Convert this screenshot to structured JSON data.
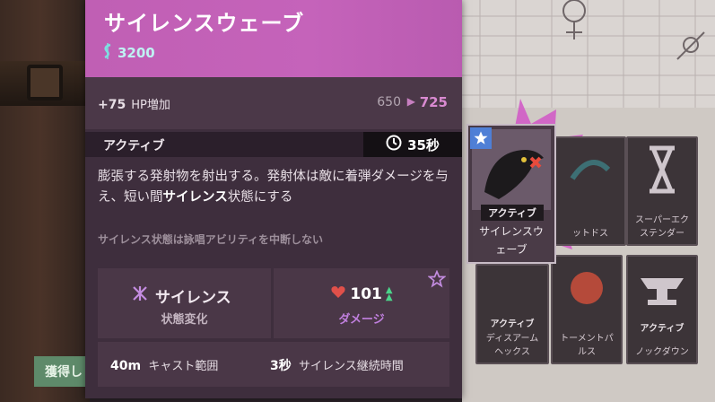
{
  "background": {
    "acquire_button_label": "獲得し"
  },
  "board_cards": {
    "selected": {
      "tag": "アクティブ",
      "name_line1": "サイレンスウ",
      "name_line2": "ェーブ"
    },
    "cards": [
      {
        "tag": "",
        "name_line1": "ットドス",
        "name_line2": ""
      },
      {
        "tag": "",
        "name_line1": "スーパーエク",
        "name_line2": "ステンダー"
      },
      {
        "tag": "アクティブ",
        "name_line1": "ディスアーム",
        "name_line2": "ヘックス"
      },
      {
        "tag": "",
        "name_line1": "トーメントパ",
        "name_line2": "ルス"
      },
      {
        "tag": "アクティブ",
        "name_line1": "ノックダウン",
        "name_line2": ""
      }
    ]
  },
  "tooltip": {
    "title": "サイレンスウェーブ",
    "price": "3200",
    "stat": {
      "plus": "+75",
      "label": "HP増加",
      "old_value": "650",
      "new_value": "725"
    },
    "active_label": "アクティブ",
    "cooldown": "35秒",
    "description_part1": "膨張する発射物を射出する。発射体は敵に着弾ダメージを与え、短い間",
    "description_bold": "サイレンス",
    "description_part2": "状態にする",
    "note": "サイレンス状態は詠唱アビリティを中断しない",
    "effect": {
      "name": "サイレンス",
      "sub": "状態変化"
    },
    "damage": {
      "value": "101",
      "sub": "ダメージ"
    },
    "cast_range": {
      "value": "40m",
      "label": "キャスト範囲"
    },
    "silence_duration": {
      "value": "3秒",
      "label": "サイレンス継続時間"
    }
  },
  "colors": {
    "header": "#c563ba",
    "spirit": "#c07fde",
    "souls": "#7de0e0",
    "upgrade": "#d98ad1"
  }
}
